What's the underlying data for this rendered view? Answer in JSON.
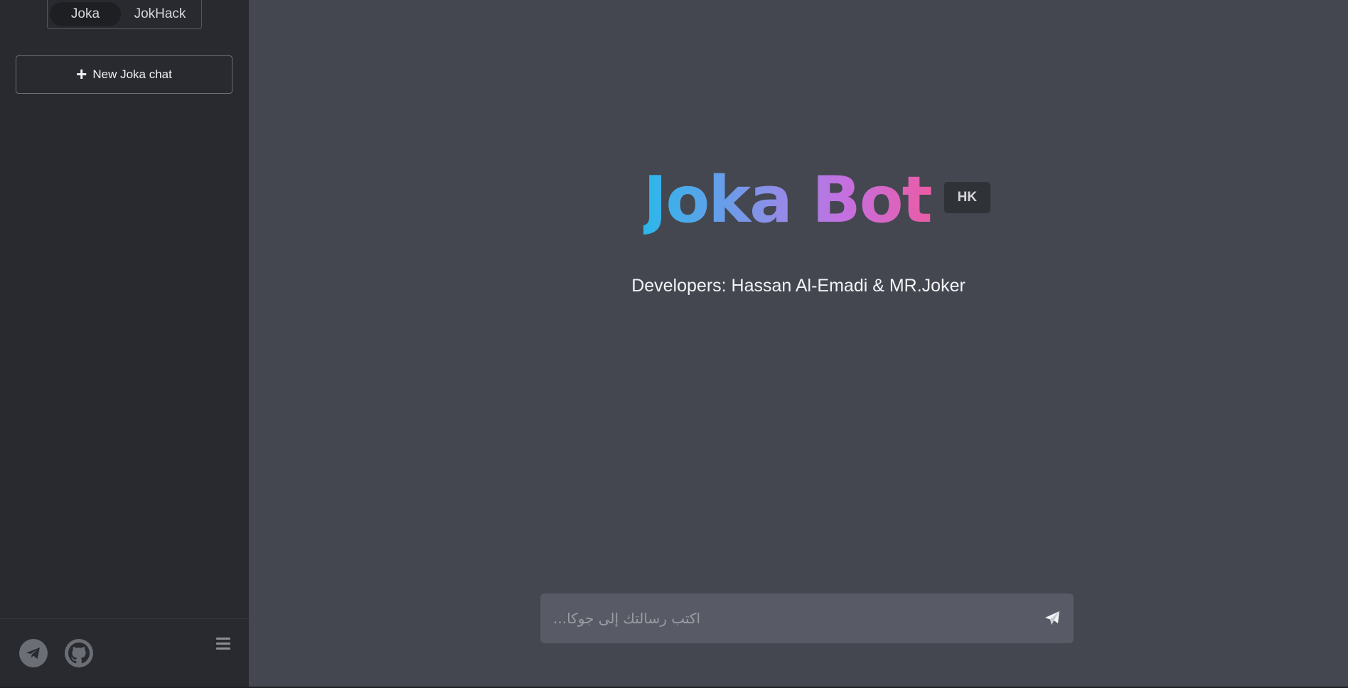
{
  "sidebar": {
    "mode_tabs": [
      {
        "label": "Joka",
        "active": true
      },
      {
        "label": "JokHack",
        "active": false
      }
    ],
    "new_chat_label": "New Joka chat",
    "footer": {
      "icons": [
        "telegram-icon",
        "github-icon",
        "menu-icon"
      ]
    }
  },
  "main": {
    "title": "Joka Bot",
    "badge": "HK",
    "developers": "Developers: Hassan Al-Emadi & MR.Joker",
    "input_placeholder": "اكتب رسالتك إلى جوكا...",
    "send_icon": "paper-plane-icon"
  },
  "colors": {
    "title_gradient": [
      "#2bb7ea",
      "#8e8ee8",
      "#c56fe0",
      "#ea5ca5"
    ],
    "sidebar_bg": "#282a2f",
    "main_bg": "#444750",
    "input_bg": "#585b65"
  }
}
